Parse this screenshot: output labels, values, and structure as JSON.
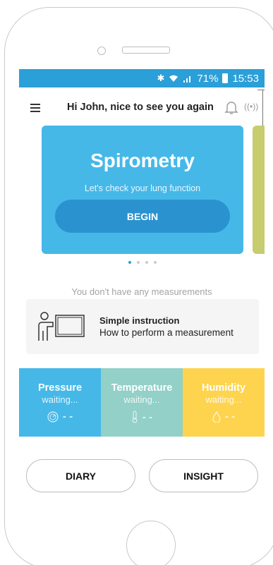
{
  "status_bar": {
    "battery": "71%",
    "time": "15:53",
    "icons": [
      "bluetooth-icon",
      "wifi-icon",
      "cell-signal-icon",
      "battery-icon"
    ]
  },
  "header": {
    "greeting": "Hi John, nice to see you again",
    "icons": [
      "menu-icon",
      "bell-icon",
      "device-signal-icon"
    ]
  },
  "carousel": {
    "cards": [
      {
        "title": "Spirometry",
        "subtitle": "Let's check your lung function",
        "button": "BEGIN",
        "color": "#45b8e8"
      }
    ],
    "next_card_color": "#c7cc6f",
    "page_count": 4,
    "active_page": 1
  },
  "measurements": {
    "empty_text": "You don't have any measurements"
  },
  "instruction": {
    "title": "Simple instruction",
    "subtitle": "How to perform a measurement"
  },
  "sensors": [
    {
      "name": "Pressure",
      "status": "waiting...",
      "value": "- -",
      "icon": "gauge-icon",
      "color": "#45b8e8"
    },
    {
      "name": "Temperature",
      "status": "waiting...",
      "value": "- -",
      "icon": "thermometer-icon",
      "color": "#92d0c8"
    },
    {
      "name": "Humidity",
      "status": "waiting...",
      "value": "- -",
      "icon": "droplet-icon",
      "color": "#fed44f"
    }
  ],
  "bottom_nav": {
    "diary": "DIARY",
    "insight": "INSIGHT"
  },
  "colors": {
    "status_bar": "#2b9fd8",
    "accent": "#2b9fd8"
  }
}
